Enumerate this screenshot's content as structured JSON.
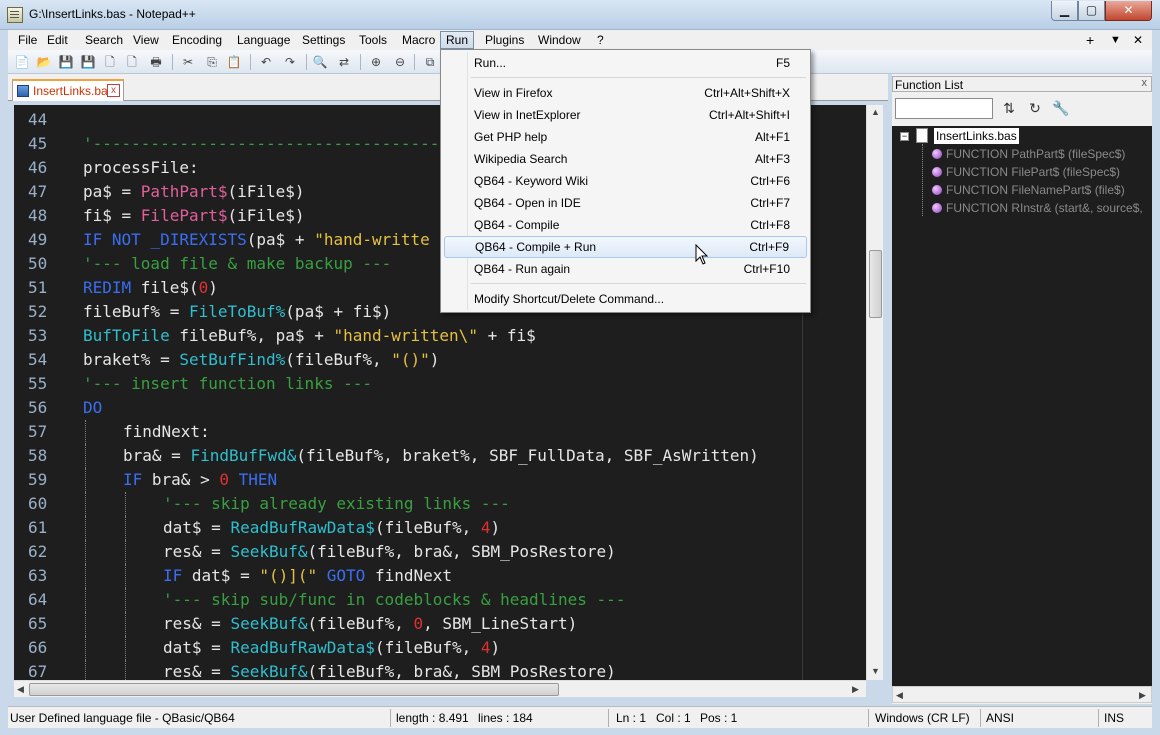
{
  "window": {
    "title": "G:\\InsertLinks.bas - Notepad++",
    "min": "▁",
    "max": "▢",
    "close": "✕"
  },
  "menu": {
    "items": [
      "File",
      "Edit",
      "Search",
      "View",
      "Encoding",
      "Language",
      "Settings",
      "Tools",
      "Macro",
      "Run",
      "Plugins",
      "Window",
      "?"
    ],
    "active": "Run",
    "right": {
      "plus": "+",
      "down": "▼",
      "close": "✕"
    }
  },
  "tab": {
    "label": "InsertLinks.bas",
    "close": "x"
  },
  "editor": {
    "lines": [
      {
        "n": "44",
        "indent": 0,
        "tokens": []
      },
      {
        "n": "45",
        "indent": 0,
        "tokens": [
          [
            "cm",
            "'------------------------------------"
          ]
        ]
      },
      {
        "n": "46",
        "indent": 0,
        "tokens": [
          [
            "white",
            "processFile:"
          ]
        ]
      },
      {
        "n": "47",
        "indent": 0,
        "tokens": [
          [
            "white",
            "pa$ = "
          ],
          [
            "pink",
            "PathPart$"
          ],
          [
            "white",
            "(iFile$)"
          ]
        ]
      },
      {
        "n": "48",
        "indent": 0,
        "tokens": [
          [
            "white",
            "fi$ = "
          ],
          [
            "pink",
            "FilePart$"
          ],
          [
            "white",
            "(iFile$)"
          ]
        ]
      },
      {
        "n": "49",
        "indent": 0,
        "tokens": [
          [
            "kw",
            "IF NOT "
          ],
          [
            "kw",
            "_DIREXISTS"
          ],
          [
            "white",
            "(pa$ + "
          ],
          [
            "str",
            "\"hand-writte"
          ]
        ]
      },
      {
        "n": "50",
        "indent": 0,
        "tokens": [
          [
            "cm",
            "'--- load file & make backup ---"
          ]
        ]
      },
      {
        "n": "51",
        "indent": 0,
        "tokens": [
          [
            "kw",
            "REDIM "
          ],
          [
            "white",
            "file$("
          ],
          [
            "num",
            "0"
          ],
          [
            "white",
            ")"
          ]
        ]
      },
      {
        "n": "52",
        "indent": 0,
        "tokens": [
          [
            "white",
            "fileBuf% = "
          ],
          [
            "fn",
            "FileToBuf%"
          ],
          [
            "white",
            "(pa$ + fi$)"
          ]
        ]
      },
      {
        "n": "53",
        "indent": 0,
        "tokens": [
          [
            "fn",
            "BufToFile "
          ],
          [
            "white",
            "fileBuf%, pa$ + "
          ],
          [
            "str",
            "\"hand-written\\\""
          ],
          [
            "white",
            " + fi$"
          ]
        ]
      },
      {
        "n": "54",
        "indent": 0,
        "tokens": [
          [
            "white",
            "braket% = "
          ],
          [
            "fn",
            "SetBufFind%"
          ],
          [
            "white",
            "(fileBuf%, "
          ],
          [
            "str",
            "\"()\""
          ],
          [
            "white",
            ")"
          ]
        ]
      },
      {
        "n": "55",
        "indent": 0,
        "tokens": [
          [
            "cm",
            "'--- insert function links ---"
          ]
        ]
      },
      {
        "n": "56",
        "indent": 0,
        "tokens": [
          [
            "kw",
            "DO"
          ]
        ]
      },
      {
        "n": "57",
        "indent": 1,
        "tokens": [
          [
            "white",
            "findNext:"
          ]
        ]
      },
      {
        "n": "58",
        "indent": 1,
        "tokens": [
          [
            "white",
            "bra& = "
          ],
          [
            "fn",
            "FindBufFwd&"
          ],
          [
            "white",
            "(fileBuf%, braket%, SBF_FullData, SBF_AsWritten)"
          ]
        ]
      },
      {
        "n": "59",
        "indent": 1,
        "tokens": [
          [
            "kw",
            "IF "
          ],
          [
            "white",
            "bra& > "
          ],
          [
            "num",
            "0"
          ],
          [
            "kw",
            " THEN"
          ]
        ]
      },
      {
        "n": "60",
        "indent": 2,
        "tokens": [
          [
            "cm",
            "'--- skip already existing links ---"
          ]
        ]
      },
      {
        "n": "61",
        "indent": 2,
        "tokens": [
          [
            "white",
            "dat$ = "
          ],
          [
            "fn",
            "ReadBufRawData$"
          ],
          [
            "white",
            "(fileBuf%, "
          ],
          [
            "num",
            "4"
          ],
          [
            "white",
            ")"
          ]
        ]
      },
      {
        "n": "62",
        "indent": 2,
        "tokens": [
          [
            "white",
            "res& = "
          ],
          [
            "fn",
            "SeekBuf&"
          ],
          [
            "white",
            "(fileBuf%, bra&, SBM_PosRestore)"
          ]
        ]
      },
      {
        "n": "63",
        "indent": 2,
        "tokens": [
          [
            "kw",
            "IF "
          ],
          [
            "white",
            "dat$ = "
          ],
          [
            "str",
            "\"()](\""
          ],
          [
            "kw",
            " GOTO "
          ],
          [
            "white",
            "findNext"
          ]
        ]
      },
      {
        "n": "64",
        "indent": 2,
        "tokens": [
          [
            "cm",
            "'--- skip sub/func in codeblocks & headlines ---"
          ]
        ]
      },
      {
        "n": "65",
        "indent": 2,
        "tokens": [
          [
            "white",
            "res& = "
          ],
          [
            "fn",
            "SeekBuf&"
          ],
          [
            "white",
            "(fileBuf%, "
          ],
          [
            "num",
            "0"
          ],
          [
            "white",
            ", SBM_LineStart)"
          ]
        ]
      },
      {
        "n": "66",
        "indent": 2,
        "tokens": [
          [
            "white",
            "dat$ = "
          ],
          [
            "fn",
            "ReadBufRawData$"
          ],
          [
            "white",
            "(fileBuf%, "
          ],
          [
            "num",
            "4"
          ],
          [
            "white",
            ")"
          ]
        ]
      },
      {
        "n": "67",
        "indent": 2,
        "tokens": [
          [
            "white",
            "res& = "
          ],
          [
            "fn",
            "SeekBuf&"
          ],
          [
            "white",
            "(fileBuf%, bra&, SBM_PosRestore)"
          ]
        ]
      }
    ]
  },
  "function_list": {
    "title": "Function List",
    "close": "x",
    "search_value": "",
    "root": "InsertLinks.bas",
    "items": [
      "FUNCTION PathPart$ (fileSpec$)",
      "FUNCTION FilePart$ (fileSpec$)",
      "FUNCTION FileNamePart$ (file$)",
      "FUNCTION RInstr& (start&, source$,"
    ]
  },
  "run_menu": {
    "items": [
      {
        "label": "Run...",
        "shortcut": "F5"
      },
      {
        "sep": true
      },
      {
        "label": "View in Firefox",
        "shortcut": "Ctrl+Alt+Shift+X"
      },
      {
        "label": "View in InetExplorer",
        "shortcut": "Ctrl+Alt+Shift+I"
      },
      {
        "label": "Get PHP help",
        "shortcut": "Alt+F1"
      },
      {
        "label": "Wikipedia Search",
        "shortcut": "Alt+F3"
      },
      {
        "label": "QB64 - Keyword Wiki",
        "shortcut": "Ctrl+F6"
      },
      {
        "label": "QB64 - Open in IDE",
        "shortcut": "Ctrl+F7"
      },
      {
        "label": "QB64 - Compile",
        "shortcut": "Ctrl+F8"
      },
      {
        "label": "QB64 - Compile + Run",
        "shortcut": "Ctrl+F9",
        "highlighted": true
      },
      {
        "label": "QB64 - Run again",
        "shortcut": "Ctrl+F10"
      },
      {
        "sep": true
      },
      {
        "label": "Modify Shortcut/Delete Command...",
        "shortcut": ""
      }
    ]
  },
  "status": {
    "language": "User Defined language file - QBasic/QB64",
    "length": "length : 8.491",
    "lines": "lines : 184",
    "ln": "Ln : 1",
    "col": "Col : 1",
    "pos": "Pos : 1",
    "eol": "Windows (CR LF)",
    "encoding": "ANSI",
    "mode": "INS"
  },
  "colors": {
    "keyword": "#3a6ef0",
    "function": "#2fbfd0",
    "string": "#e6c040",
    "number": "#e03030",
    "comment": "#38a040",
    "user_function": "#e0609a",
    "editor_bg": "#1e1e1e"
  }
}
